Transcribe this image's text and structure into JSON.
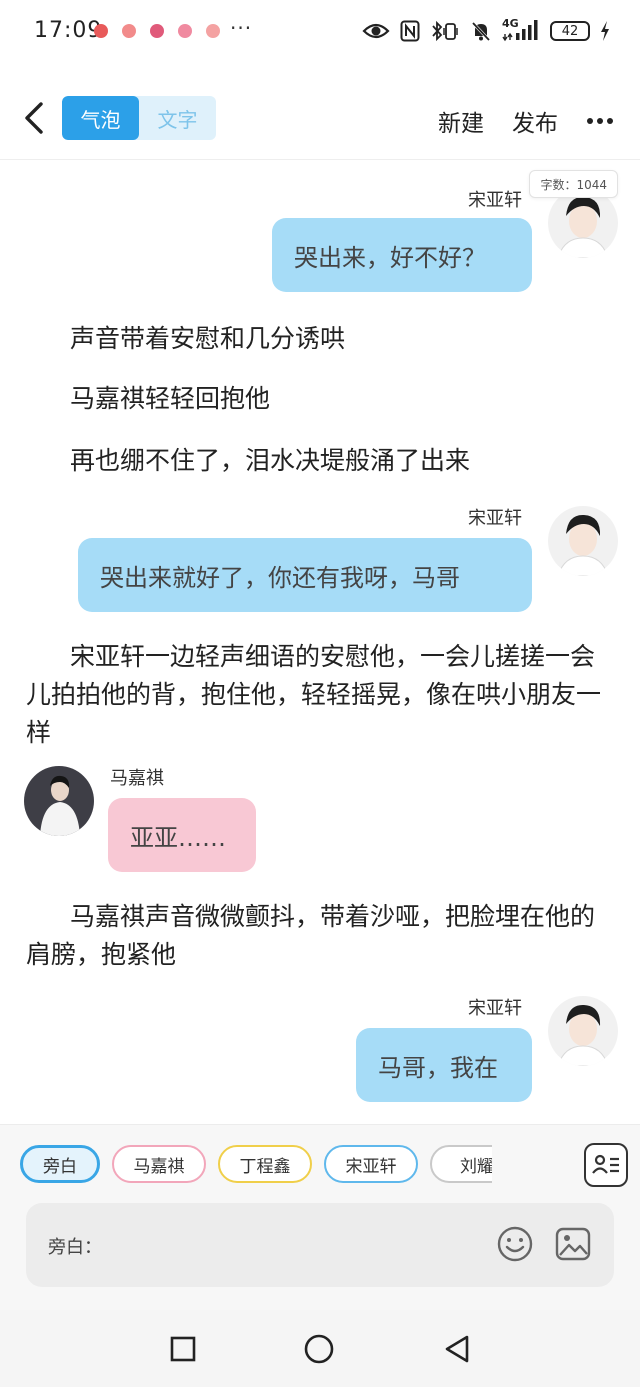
{
  "status_bar": {
    "time": "17:09",
    "more": "···",
    "network_label": "4G",
    "battery": "42",
    "notification_colors": [
      "#e85a5a",
      "#f28b8b",
      "#e05a7a",
      "#f08aa0",
      "#f4a2a2"
    ]
  },
  "top_bar": {
    "back_icon": "chevron-left-icon",
    "mode_tabs": [
      {
        "label": "气泡",
        "active": true
      },
      {
        "label": "文字",
        "active": false
      }
    ],
    "new_label": "新建",
    "publish_label": "发布",
    "more_icon": "more-horizontal-icon"
  },
  "word_count": "字数：1044",
  "messages": [
    {
      "sender": "宋亚轩",
      "text": "哭出来，好不好？",
      "side": "right",
      "color": "#a6dcf7"
    },
    {
      "narration": "声音带着安慰和几分诱哄"
    },
    {
      "narration": "马嘉祺轻轻回抱他"
    },
    {
      "narration": "再也绷不住了，泪水决堤般涌了出来"
    },
    {
      "sender": "宋亚轩",
      "text": "哭出来就好了，你还有我呀，马哥",
      "side": "right",
      "color": "#a6dcf7"
    },
    {
      "narration": "宋亚轩一边轻声细语的安慰他，一会儿搓搓一会儿拍拍他的背，抱住他，轻轻摇晃，像在哄小朋友一样"
    },
    {
      "sender": "马嘉祺",
      "text": "亚亚……",
      "side": "left",
      "color": "#f8c8d4"
    },
    {
      "narration": "马嘉祺声音微微颤抖，带着沙哑，把脸埋在他的肩膀，抱紧他"
    },
    {
      "sender": "宋亚轩",
      "text": "马哥，我在",
      "side": "right",
      "color": "#a6dcf7"
    }
  ],
  "characters": [
    {
      "label": "旁白",
      "color": "#39a6e6",
      "selected": true
    },
    {
      "label": "马嘉祺",
      "color": "#f2a6ba",
      "selected": false
    },
    {
      "label": "丁程鑫",
      "color": "#f0cf4a",
      "selected": false
    },
    {
      "label": "宋亚轩",
      "color": "#5fb8ec",
      "selected": false
    },
    {
      "label": "刘耀",
      "color": "#c9c9c9",
      "selected": false
    }
  ],
  "input": {
    "placeholder": "旁白：",
    "emoji_icon": "smiley-icon",
    "image_icon": "image-icon",
    "cast_icon": "contact-list-icon"
  },
  "nav_bar": {
    "recent_icon": "square-icon",
    "home_icon": "circle-icon",
    "back_icon": "triangle-back-icon"
  }
}
